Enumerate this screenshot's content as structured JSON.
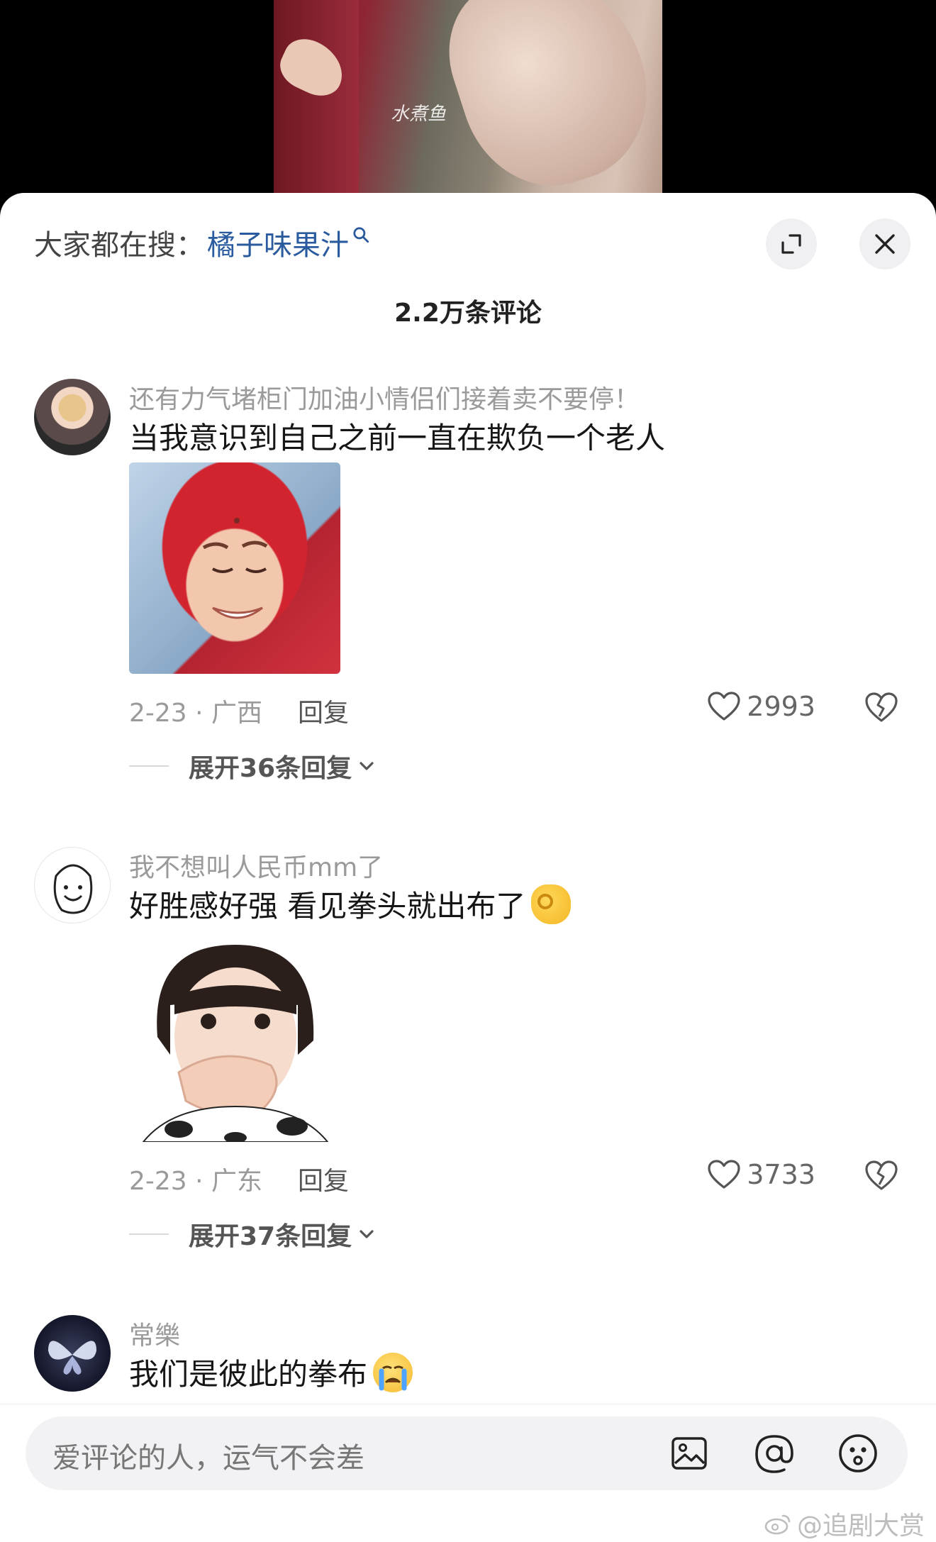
{
  "video": {
    "watermark": "水煮鱼"
  },
  "header": {
    "search_prefix": "大家都在搜：",
    "search_keyword": "橘子味果汁"
  },
  "comments_count_title": "2.2万条评论",
  "comments": [
    {
      "user": "还有力气堵柜门加油小情侣们接着卖不要停！",
      "text": "当我意识到自己之前一直在欺负一个老人",
      "meta": "2-23 · 广西",
      "reply_label": "回复",
      "likes": "2993",
      "expand": "展开36条回复"
    },
    {
      "user": "我不想叫人民币mm了",
      "text": "好胜感好强 看见拳头就出布了",
      "emoji": "ok-hand-emoji",
      "meta": "2-23 · 广东",
      "reply_label": "回复",
      "likes": "3733",
      "expand": "展开37条回复"
    },
    {
      "user": "常樂",
      "text": "我们是彼此的拳布",
      "emoji": "crying-face-emoji"
    }
  ],
  "input": {
    "placeholder": "爱评论的人，运气不会差"
  },
  "corner_watermark": "@追剧大赏",
  "colors": {
    "keyword": "#2a5b9e",
    "muted": "#9a9a9a"
  }
}
